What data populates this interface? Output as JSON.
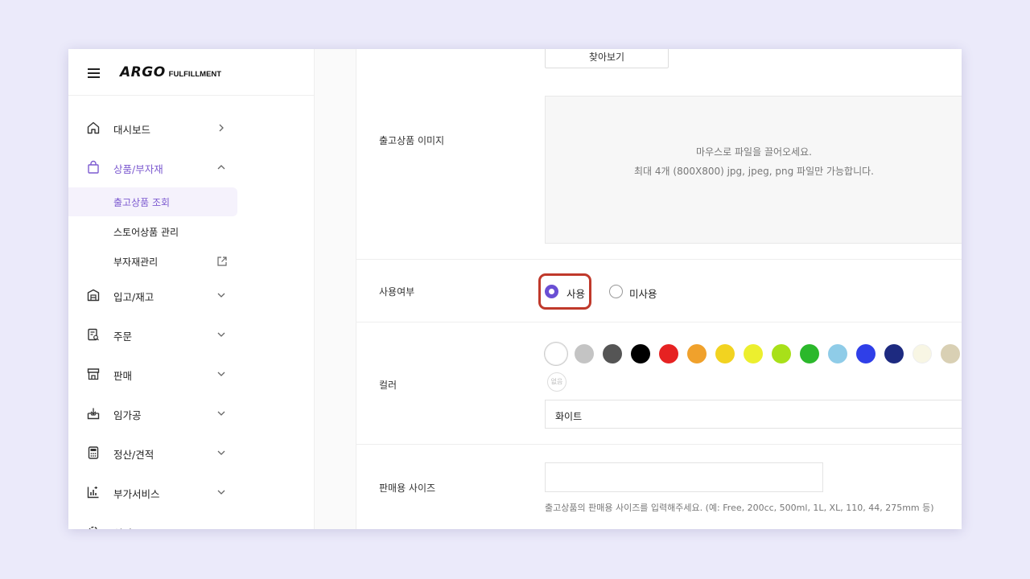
{
  "header": {
    "logo_mark": "ARGO",
    "logo_sub": "FULFILLMENT"
  },
  "sidebar": {
    "items": [
      {
        "label": "대시보드",
        "icon": "home-icon",
        "chevron": "right"
      },
      {
        "label": "상품/부자재",
        "icon": "bag-icon",
        "chevron": "up",
        "active": true
      },
      {
        "label": "입고/재고",
        "icon": "warehouse-icon",
        "chevron": "down"
      },
      {
        "label": "주문",
        "icon": "order-icon",
        "chevron": "down"
      },
      {
        "label": "판매",
        "icon": "store-icon",
        "chevron": "down"
      },
      {
        "label": "임가공",
        "icon": "process-icon",
        "chevron": "down"
      },
      {
        "label": "정산/견적",
        "icon": "calculator-icon",
        "chevron": "down"
      },
      {
        "label": "부가서비스",
        "icon": "chart-icon",
        "chevron": "down"
      },
      {
        "label": "설정",
        "icon": "gear-icon",
        "chevron": "down"
      }
    ],
    "sub_items": [
      {
        "label": "출고상품 조회",
        "selected": true
      },
      {
        "label": "스토어상품 관리"
      },
      {
        "label": "부자재관리",
        "external": true
      }
    ],
    "accent_color": "#7d5bd0"
  },
  "form": {
    "browse_button": "찾아보기",
    "image_label": "출고상품 이미지",
    "dropzone_line1": "마우스로 파일을 끌어오세요.",
    "dropzone_line2": "최대 4개 (800X800) jpg, jpeg, png  파일만 가능합니다.",
    "usage_label": "사용여부",
    "usage_options": [
      "사용",
      "미사용"
    ],
    "usage_selected": "사용",
    "color_label": "컬러",
    "color_swatches": [
      "#ffffff",
      "#c4c4c4",
      "#555555",
      "#000000",
      "#e62222",
      "#f0a12c",
      "#f2d320",
      "#ecef2e",
      "#a8e019",
      "#2bb82b",
      "#8fcce8",
      "#2f3fe8",
      "#1d2a80",
      "#f8f6e4",
      "#d9d0b4",
      "#7d8a3a",
      "#9a5a2e",
      "#8a2be2"
    ],
    "color_none_label": "없음",
    "color_value": "화이트",
    "size_label": "판매용 사이즈",
    "size_value": "",
    "size_hint": "출고상품의 판매용 사이즈를 입력해주세요. (예: Free, 200cc, 500ml, 1L, XL, 110, 44, 275mm 등)",
    "highlight_color": "#c0392b"
  }
}
